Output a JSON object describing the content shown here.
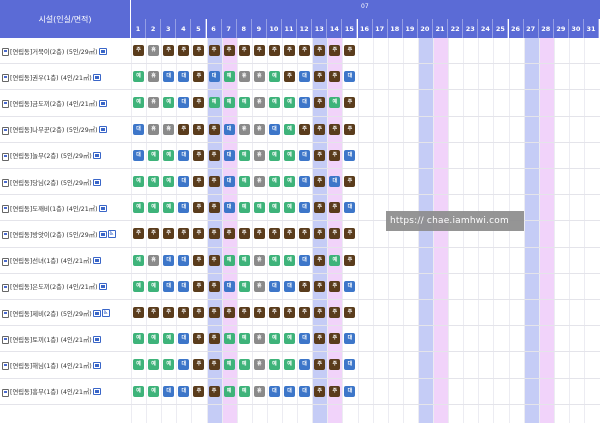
{
  "header": {
    "facility_label": "시설(인실/면적)",
    "month_label": "07",
    "days": [
      "1",
      "2",
      "3",
      "4",
      "5",
      "6",
      "7",
      "8",
      "9",
      "10",
      "11",
      "12",
      "13",
      "14",
      "15",
      "16",
      "17",
      "18",
      "19",
      "20",
      "21",
      "22",
      "23",
      "24",
      "25",
      "26",
      "27",
      "28",
      "29",
      "30",
      "31"
    ]
  },
  "weekend": {
    "saturday_days": [
      6,
      13,
      20,
      27
    ],
    "sunday_days": [
      7,
      14,
      21,
      28
    ]
  },
  "legend": {
    "b": "주",
    "g": "예",
    "x": "휴",
    "u": "대"
  },
  "colors": {
    "header": "#5b6bd6",
    "saturday": "#c5ccf6",
    "sunday": "#f1d3fa",
    "brown": "#5a3c1c",
    "green": "#3eb37a",
    "gray": "#8a8a8a",
    "blue": "#3d76c9"
  },
  "facilities": [
    {
      "name": "[연립동]거북이(2층) (5인/29㎡)",
      "wheelchair": false,
      "status": [
        "b",
        "x",
        "b",
        "b",
        "b",
        "b",
        "b",
        "b",
        "b",
        "b",
        "b",
        "b",
        "b",
        "b",
        "b"
      ]
    },
    {
      "name": "[연립동]권우(1층) (4인/21㎡)",
      "wheelchair": false,
      "status": [
        "g",
        "x",
        "u",
        "u",
        "b",
        "u",
        "g",
        "x",
        "x",
        "g",
        "b",
        "u",
        "b",
        "b",
        "u"
      ]
    },
    {
      "name": "[연립동]금도끼(2층) (4인/21㎡)",
      "wheelchair": false,
      "status": [
        "g",
        "x",
        "g",
        "u",
        "b",
        "g",
        "g",
        "g",
        "x",
        "g",
        "g",
        "u",
        "b",
        "g",
        "b"
      ]
    },
    {
      "name": "[연립동]나무꾼(2층) (5인/29㎡)",
      "wheelchair": false,
      "status": [
        "u",
        "x",
        "x",
        "b",
        "b",
        "b",
        "u",
        "x",
        "x",
        "u",
        "g",
        "b",
        "b",
        "b",
        "b"
      ]
    },
    {
      "name": "[연립동]놀부(2층) (5인/29㎡)",
      "wheelchair": false,
      "status": [
        "u",
        "g",
        "g",
        "u",
        "b",
        "b",
        "u",
        "g",
        "x",
        "g",
        "g",
        "u",
        "b",
        "b",
        "u"
      ]
    },
    {
      "name": "[연립동]당님(2층) (5인/29㎡)",
      "wheelchair": false,
      "status": [
        "g",
        "g",
        "g",
        "u",
        "b",
        "b",
        "u",
        "g",
        "x",
        "g",
        "g",
        "u",
        "b",
        "u",
        "b"
      ]
    },
    {
      "name": "[연립동]도깨비(1층) (4인/21㎡)",
      "wheelchair": false,
      "status": [
        "g",
        "g",
        "g",
        "u",
        "b",
        "b",
        "u",
        "g",
        "g",
        "g",
        "g",
        "u",
        "b",
        "b",
        "u"
      ]
    },
    {
      "name": "[연립동]방앗이(2층) (5인/29㎡)",
      "wheelchair": true,
      "status": [
        "b",
        "b",
        "b",
        "b",
        "b",
        "b",
        "b",
        "b",
        "b",
        "b",
        "b",
        "b",
        "b",
        "b",
        "b"
      ]
    },
    {
      "name": "[연립동]선녀(1층) (4인/21㎡)",
      "wheelchair": false,
      "status": [
        "g",
        "x",
        "u",
        "u",
        "b",
        "b",
        "g",
        "g",
        "x",
        "g",
        "g",
        "u",
        "b",
        "g",
        "b"
      ]
    },
    {
      "name": "[연립동]은도끼(2층) (4인/21㎡)",
      "wheelchair": false,
      "status": [
        "g",
        "g",
        "u",
        "u",
        "b",
        "b",
        "u",
        "g",
        "x",
        "u",
        "u",
        "b",
        "b",
        "b",
        "u"
      ]
    },
    {
      "name": "[연립동]제비(2층) (5인/29㎡)",
      "wheelchair": true,
      "status": [
        "b",
        "b",
        "b",
        "b",
        "b",
        "b",
        "b",
        "b",
        "b",
        "b",
        "b",
        "b",
        "b",
        "b",
        "b"
      ]
    },
    {
      "name": "[연립동]토끼(1층) (4인/21㎡)",
      "wheelchair": false,
      "status": [
        "g",
        "g",
        "g",
        "u",
        "b",
        "b",
        "g",
        "g",
        "x",
        "g",
        "g",
        "u",
        "b",
        "b",
        "u"
      ]
    },
    {
      "name": "[연립동]해님(1층) (4인/21㎡)",
      "wheelchair": false,
      "status": [
        "g",
        "g",
        "g",
        "u",
        "b",
        "b",
        "g",
        "g",
        "x",
        "g",
        "g",
        "u",
        "b",
        "b",
        "u"
      ]
    },
    {
      "name": "[연립동]흥부(1층) (4인/21㎡)",
      "wheelchair": false,
      "status": [
        "g",
        "g",
        "u",
        "u",
        "b",
        "b",
        "g",
        "g",
        "x",
        "u",
        "u",
        "u",
        "b",
        "b",
        "u"
      ]
    }
  ],
  "watermark": "https:// chae.iamhwi.com"
}
